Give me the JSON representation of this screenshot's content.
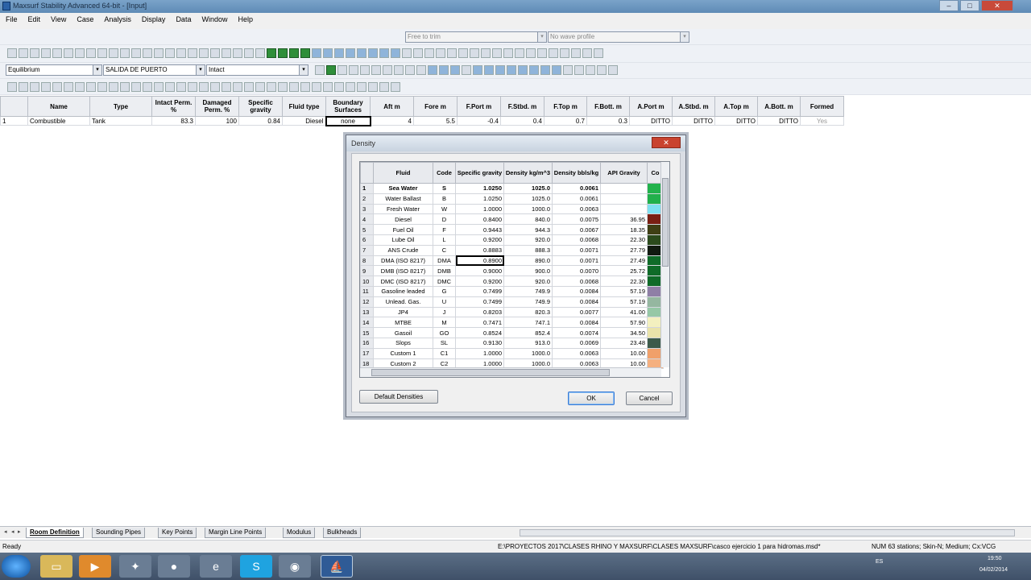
{
  "window": {
    "title": "Maxsurf Stability Advanced 64-bit - [Input]",
    "min": "–",
    "max": "□",
    "close": "✕"
  },
  "menu": [
    "File",
    "Edit",
    "View",
    "Case",
    "Analysis",
    "Display",
    "Data",
    "Window",
    "Help"
  ],
  "toolbar": {
    "free_to_trim": "Free to trim",
    "wave_profile": "No wave profile",
    "analysis_type": "Equilibrium",
    "loadcase": "SALIDA DE PUERTO",
    "damage": "Intact"
  },
  "room_table": {
    "headers": [
      "",
      "Name",
      "Type",
      "Intact Perm. %",
      "Damaged Perm. %",
      "Specific gravity",
      "Fluid type",
      "Boundary Surfaces",
      "Aft m",
      "Fore m",
      "F.Port m",
      "F.Stbd. m",
      "F.Top m",
      "F.Bott. m",
      "A.Port m",
      "A.Stbd. m",
      "A.Top m",
      "A.Bott. m",
      "Formed"
    ],
    "rows": [
      [
        "1",
        "Combustible",
        "Tank",
        "83.3",
        "100",
        "0.84",
        "Diesel",
        "none",
        "4",
        "5.5",
        "-0.4",
        "0.4",
        "0.7",
        "0.3",
        "DITTO",
        "DITTO",
        "DITTO",
        "DITTO",
        "Yes"
      ]
    ]
  },
  "dialog": {
    "title": "Density",
    "close": "✕",
    "headers": [
      "",
      "Fluid",
      "Code",
      "Specific gravity",
      "Density kg/m^3",
      "Density bbls/kg",
      "API Gravity",
      "Co"
    ],
    "rows": [
      [
        "1",
        "Sea Water",
        "S",
        "1.0250",
        "1025.0",
        "0.0061",
        ""
      ],
      [
        "2",
        "Water Ballast",
        "B",
        "1.0250",
        "1025.0",
        "0.0061",
        ""
      ],
      [
        "3",
        "Fresh Water",
        "W",
        "1.0000",
        "1000.0",
        "0.0063",
        ""
      ],
      [
        "4",
        "Diesel",
        "D",
        "0.8400",
        "840.0",
        "0.0075",
        "36.95"
      ],
      [
        "5",
        "Fuel Oil",
        "F",
        "0.9443",
        "944.3",
        "0.0067",
        "18.35"
      ],
      [
        "6",
        "Lube Oil",
        "L",
        "0.9200",
        "920.0",
        "0.0068",
        "22.30"
      ],
      [
        "7",
        "ANS Crude",
        "C",
        "0.8883",
        "888.3",
        "0.0071",
        "27.79"
      ],
      [
        "8",
        "DMA (ISO 8217)",
        "DMA",
        "0.8900",
        "890.0",
        "0.0071",
        "27.49"
      ],
      [
        "9",
        "DMB (ISO 8217)",
        "DMB",
        "0.9000",
        "900.0",
        "0.0070",
        "25.72"
      ],
      [
        "10",
        "DMC (ISO 8217)",
        "DMC",
        "0.9200",
        "920.0",
        "0.0068",
        "22.30"
      ],
      [
        "11",
        "Gasoline leaded",
        "G",
        "0.7499",
        "749.9",
        "0.0084",
        "57.19"
      ],
      [
        "12",
        "Unlead. Gas.",
        "U",
        "0.7499",
        "749.9",
        "0.0084",
        "57.19"
      ],
      [
        "13",
        "JP4",
        "J",
        "0.8203",
        "820.3",
        "0.0077",
        "41.00"
      ],
      [
        "14",
        "MTBE",
        "M",
        "0.7471",
        "747.1",
        "0.0084",
        "57.90"
      ],
      [
        "15",
        "Gasoil",
        "GO",
        "0.8524",
        "852.4",
        "0.0074",
        "34.50"
      ],
      [
        "16",
        "Slops",
        "SL",
        "0.9130",
        "913.0",
        "0.0069",
        "23.48"
      ],
      [
        "17",
        "Custom 1",
        "C1",
        "1.0000",
        "1000.0",
        "0.0063",
        "10.00"
      ],
      [
        "18",
        "Custom 2",
        "C2",
        "1.0000",
        "1000.0",
        "0.0063",
        "10.00"
      ]
    ],
    "colors": [
      "#22b24c",
      "#21b04b",
      "#7fe0f0",
      "#7a1f12",
      "#3f3f14",
      "#2b4a1c",
      "#111a10",
      "#0f6b28",
      "#0f6b28",
      "#0f6b28",
      "#8f7fa6",
      "#95b7a0",
      "#96c8a6",
      "#f3f0bf",
      "#e9e3aa",
      "#3c5a4a",
      "#f0a06a",
      "#f5b080"
    ],
    "default_button": "Default Densities",
    "ok": "OK",
    "cancel": "Cancel"
  },
  "tabs": [
    "Room Definition",
    "Sounding Pipes",
    "Key Points",
    "Margin Line Points",
    "Modulus",
    "Bulkheads"
  ],
  "status": {
    "ready": "Ready",
    "path": "E:\\PROYECTOS 2017\\CLASES RHINO Y MAXSURF\\CLASES MAXSURF\\casco ejercicio 1 para hidromas.msd*",
    "info": "NUM  63 stations; Skin-N; Medium; Cx:VCG"
  },
  "taskbar": {
    "lang": "ES",
    "time": "19:50",
    "date": "04/02/2014",
    "apps": [
      "start-orb-icon",
      "folder-icon",
      "media-player-icon",
      "network-icon",
      "paint-icon",
      "internet-explorer-icon",
      "skype-icon",
      "chrome-icon",
      "maxsurf-icon"
    ]
  }
}
